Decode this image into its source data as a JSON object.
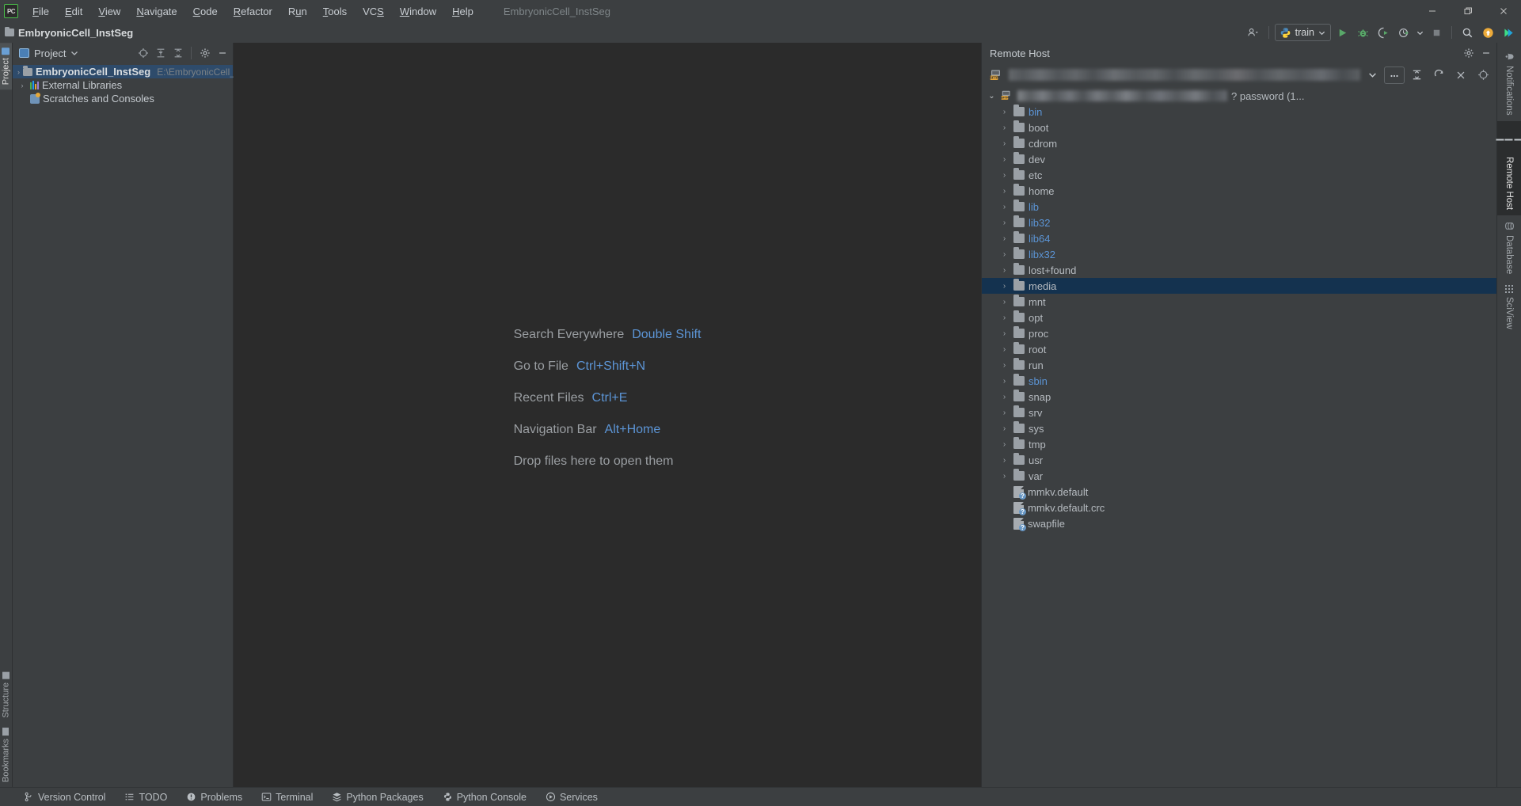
{
  "window": {
    "app_icon": "pycharm-logo",
    "project_name": "EmbryonicCell_InstSeg",
    "menu": [
      {
        "label": "File",
        "icon": ""
      },
      {
        "label": "Edit",
        "icon": ""
      },
      {
        "label": "View",
        "icon": ""
      },
      {
        "label": "Navigate",
        "icon": ""
      },
      {
        "label": "Code",
        "icon": ""
      },
      {
        "label": "Refactor",
        "icon": ""
      },
      {
        "label": "Run",
        "icon": ""
      },
      {
        "label": "Tools",
        "icon": ""
      },
      {
        "label": "VCS",
        "icon": ""
      },
      {
        "label": "Window",
        "icon": ""
      },
      {
        "label": "Help",
        "icon": ""
      }
    ],
    "controls": {
      "minimize": "minimize-icon",
      "restore": "restore-icon",
      "close": "close-icon"
    }
  },
  "navbar": {
    "breadcrumb": "EmbryonicCell_InstSeg",
    "run_config": "train",
    "buttons": [
      "settings-sync-icon",
      "run-icon",
      "debug-icon",
      "run-coverage-icon",
      "profile-icon",
      "stop-icon",
      "search-icon",
      "update-project-icon",
      "pycharm-pro-icon"
    ]
  },
  "left_stripe": {
    "top": [
      {
        "label": "Project",
        "icon": "project-icon",
        "active": true
      }
    ],
    "bottom": [
      {
        "label": "Structure",
        "icon": "structure-icon",
        "active": false
      },
      {
        "label": "Bookmarks",
        "icon": "bookmarks-icon",
        "active": false
      }
    ]
  },
  "right_stripe": [
    {
      "label": "Notifications",
      "icon": "bell-icon",
      "active": false
    },
    {
      "label": "Remote Host",
      "icon": "remote-host-icon",
      "active": true
    },
    {
      "label": "Database",
      "icon": "database-icon",
      "active": false
    },
    {
      "label": "SciView",
      "icon": "sciview-icon",
      "active": false
    }
  ],
  "project_panel": {
    "title": "Project",
    "dropdown_icon": "chevron-down-icon",
    "toolbar": [
      "select-opened-file-icon",
      "expand-all-icon",
      "collapse-all-icon",
      "settings-gear-icon",
      "hide-icon"
    ],
    "tree": [
      {
        "label": "EmbryonicCell_InstSeg",
        "path": "E:\\EmbryonicCell_InstSeg",
        "icon": "folder-icon",
        "arrow": "›",
        "bold": true,
        "selected": true,
        "indent": 0
      },
      {
        "label": "External Libraries",
        "path": "",
        "icon": "library-icon",
        "arrow": "›",
        "bold": false,
        "selected": false,
        "indent": 0
      },
      {
        "label": "Scratches and Consoles",
        "path": "",
        "icon": "scratches-icon",
        "arrow": "",
        "bold": false,
        "selected": false,
        "indent": 0
      }
    ]
  },
  "editor": {
    "shortcuts": [
      {
        "label": "Search Everywhere",
        "key": "Double Shift"
      },
      {
        "label": "Go to File",
        "key": "Ctrl+Shift+N"
      },
      {
        "label": "Recent Files",
        "key": "Ctrl+E"
      },
      {
        "label": "Navigation Bar",
        "key": "Alt+Home"
      }
    ],
    "drop_hint": "Drop files here to open them"
  },
  "remote_panel": {
    "title": "Remote Host",
    "header_icons": [
      "settings-gear-icon",
      "hide-icon"
    ],
    "host_value": "",
    "host_value_redacted": true,
    "connection_icon": "sftp-icon",
    "toolbar": [
      "chevron-down-icon",
      "browse-ellipsis-icon",
      "collapse-all-icon",
      "refresh-icon",
      "close-icon",
      "locate-icon"
    ],
    "root_row": {
      "arrow": "⌄",
      "icon": "sftp-icon",
      "redacted": true,
      "suffix": "? password (1..."
    },
    "tree": [
      {
        "name": "bin",
        "type": "folder",
        "link": true,
        "arrow": "›",
        "selected": false
      },
      {
        "name": "boot",
        "type": "folder",
        "link": false,
        "arrow": "›",
        "selected": false
      },
      {
        "name": "cdrom",
        "type": "folder",
        "link": false,
        "arrow": "›",
        "selected": false
      },
      {
        "name": "dev",
        "type": "folder",
        "link": false,
        "arrow": "›",
        "selected": false
      },
      {
        "name": "etc",
        "type": "folder",
        "link": false,
        "arrow": "›",
        "selected": false
      },
      {
        "name": "home",
        "type": "folder",
        "link": false,
        "arrow": "›",
        "selected": false
      },
      {
        "name": "lib",
        "type": "folder",
        "link": true,
        "arrow": "›",
        "selected": false
      },
      {
        "name": "lib32",
        "type": "folder",
        "link": true,
        "arrow": "›",
        "selected": false
      },
      {
        "name": "lib64",
        "type": "folder",
        "link": true,
        "arrow": "›",
        "selected": false
      },
      {
        "name": "libx32",
        "type": "folder",
        "link": true,
        "arrow": "›",
        "selected": false
      },
      {
        "name": "lost+found",
        "type": "folder",
        "link": false,
        "arrow": "›",
        "selected": false
      },
      {
        "name": "media",
        "type": "folder",
        "link": false,
        "arrow": "›",
        "selected": true
      },
      {
        "name": "mnt",
        "type": "folder",
        "link": false,
        "arrow": "›",
        "selected": false
      },
      {
        "name": "opt",
        "type": "folder",
        "link": false,
        "arrow": "›",
        "selected": false
      },
      {
        "name": "proc",
        "type": "folder",
        "link": false,
        "arrow": "›",
        "selected": false
      },
      {
        "name": "root",
        "type": "folder",
        "link": false,
        "arrow": "›",
        "selected": false
      },
      {
        "name": "run",
        "type": "folder",
        "link": false,
        "arrow": "›",
        "selected": false
      },
      {
        "name": "sbin",
        "type": "folder",
        "link": true,
        "arrow": "›",
        "selected": false
      },
      {
        "name": "snap",
        "type": "folder",
        "link": false,
        "arrow": "›",
        "selected": false
      },
      {
        "name": "srv",
        "type": "folder",
        "link": false,
        "arrow": "›",
        "selected": false
      },
      {
        "name": "sys",
        "type": "folder",
        "link": false,
        "arrow": "›",
        "selected": false
      },
      {
        "name": "tmp",
        "type": "folder",
        "link": false,
        "arrow": "›",
        "selected": false
      },
      {
        "name": "usr",
        "type": "folder",
        "link": false,
        "arrow": "›",
        "selected": false
      },
      {
        "name": "var",
        "type": "folder",
        "link": false,
        "arrow": "›",
        "selected": false
      },
      {
        "name": "mmkv.default",
        "type": "file",
        "link": false,
        "arrow": "",
        "selected": false
      },
      {
        "name": "mmkv.default.crc",
        "type": "file",
        "link": false,
        "arrow": "",
        "selected": false
      },
      {
        "name": "swapfile",
        "type": "file",
        "link": false,
        "arrow": "",
        "selected": false
      }
    ]
  },
  "statusbar": [
    {
      "label": "Version Control",
      "icon": "branch-icon"
    },
    {
      "label": "TODO",
      "icon": "todo-icon"
    },
    {
      "label": "Problems",
      "icon": "problems-icon"
    },
    {
      "label": "Terminal",
      "icon": "terminal-icon"
    },
    {
      "label": "Python Packages",
      "icon": "packages-icon"
    },
    {
      "label": "Python Console",
      "icon": "python-console-icon"
    },
    {
      "label": "Services",
      "icon": "services-icon"
    }
  ],
  "colors": {
    "bg_panel": "#3c3f41",
    "bg_editor": "#2b2b2b",
    "accent_link": "#5c95d6",
    "selection": "#14324f",
    "project_selection": "#2e4b6b",
    "text": "#b6bbc0"
  }
}
